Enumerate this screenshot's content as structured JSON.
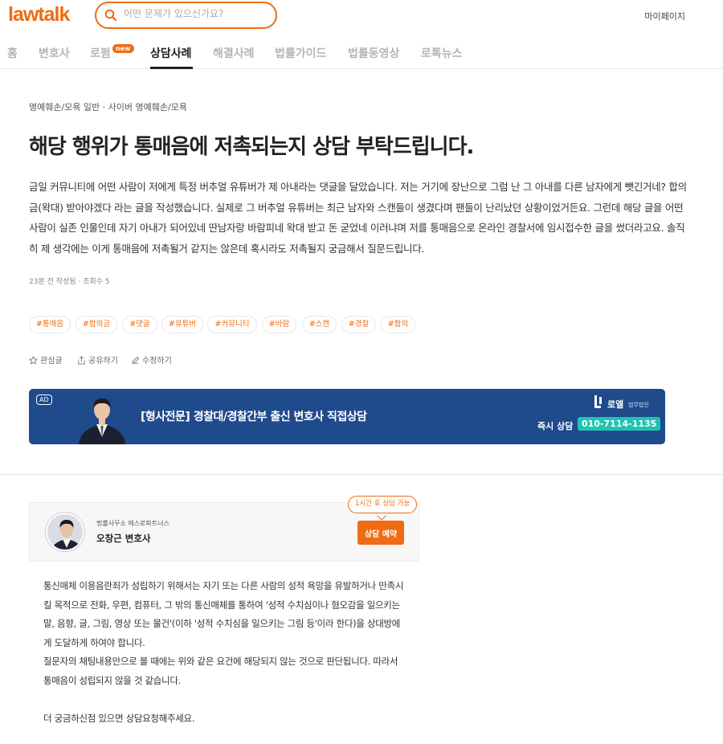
{
  "header": {
    "logo": "lawtalk",
    "search_placeholder": "어떤 문제가 있으신가요?",
    "mypage": "마이페이지"
  },
  "nav": {
    "items": [
      "홈",
      "변호사",
      "로펌",
      "상담사례",
      "해결사례",
      "법률가이드",
      "법률동영상",
      "로톡뉴스"
    ],
    "active": "상담사례",
    "new_badge": "new"
  },
  "question": {
    "breadcrumb": "명예훼손/모욕 일반 · 사이버 명예훼손/모욕",
    "title": "해당 행위가 통매음에 저촉되는지 상담 부탁드립니다.",
    "body": "금일 커뮤니티에 어떤 사람이 저에게 특정 버추얼 유튜버가 제 아내라는 댓글을 달았습니다. 저는 거기에 장난으로 그럼 난 그 아내를 다른 남자에게 뺏긴거네? 합의금(왁대) 받아야겠다 라는 글을 작성했습니다. 실제로 그 버추얼 유튜버는 최근 남자와 스캔들이 생겼다며 팬들이 난리났던 상황이었거든요. 그런데 해당 글을 어떤 사람이 실존 인물인데 자기 아내가 되어있네 딴남자랑 바람피네 왁대 받고 돈 굳었네 이러냐며 저를 통매음으로 온라인 경찰서에 임시접수한 글을 썼더라고요. 솔직히 제 생각에는 이게 통매음에 저촉될거 같지는 않은데 혹시라도 저촉될지 궁금해서 질문드립니다.",
    "meta": "23분 전 작성됨 · 조회수 5",
    "tags": [
      "#통매음",
      "#합의금",
      "#댓글",
      "#유튜버",
      "#커뮤니티",
      "#바람",
      "#스캔",
      "#경찰",
      "#합의"
    ],
    "actions": {
      "bookmark": "관심글",
      "share": "공유하기",
      "edit": "수정하기"
    }
  },
  "ad": {
    "badge": "AD",
    "text": "[형사전문] 경찰대/경찰간부 출신 변호사 직접상담",
    "firm_name": "로엘",
    "firm_sub": "법무법인",
    "call_label": "즉시 상담",
    "phone": "010-7114-1135"
  },
  "answer": {
    "firm": "법률사무소 에스로파트너스",
    "lawyer_name": "오창근 변호사",
    "tooltip": "1시간 후 상담 가능",
    "reserve_button": "상담 예약",
    "paragraph1": "통신매체 이용음란죄가 성립하기 위해서는 자기 또는 다른 사람의 성적 욕망을 유발하거나 만족시킬 목적으로 전화, 우편, 컴퓨터, 그 밖의 통신매체를 통하여 '성적 수치심이나 혐오감을 일으키는 말, 음향, 글, 그림, 영상 또는 물건'(이하 '성적 수치심을 일으키는 그림 등'이라 한다)을 상대방에게 도달하게 하여야 합니다.",
    "paragraph2": "질문자의 채팅내용만으로 볼 때에는 위와 같은 요건에 해당되지 않는 것으로 판단됩니다. 따라서 통매음이 성립되지 않을 것 같습니다.",
    "paragraph3": "더 궁금하신점 있으면 상담요청해주세요."
  },
  "colors": {
    "brand": "#ef6c13",
    "banner_bg": "#1f4a8c",
    "phone_bg": "#21c3b0"
  }
}
